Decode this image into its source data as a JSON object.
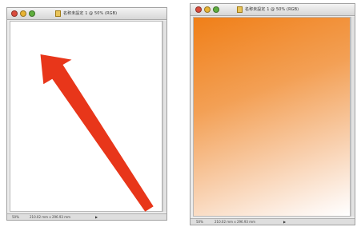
{
  "windows": [
    {
      "title": "名称未設定 1 @ 50% (RGB)",
      "status_zoom": "50%",
      "status_info": "210.02 mm x 296.93 mm",
      "canvas_fill": "white"
    },
    {
      "title": "名称未設定 1 @ 50% (RGB)",
      "status_zoom": "50%",
      "status_info": "210.02 mm x 296.93 mm",
      "canvas_fill": "orange gradient"
    }
  ],
  "colors": {
    "arrow": "#e8361a",
    "gradient_start": "#f07f18",
    "gradient_end": "#ffffff",
    "close_button": "#d94a3c",
    "minimize_button": "#e8b434",
    "zoom_button": "#5fae3e"
  },
  "icons": {
    "arrow": "arrow-icon",
    "document": "document-icon",
    "status_menu": "triangle-icon"
  }
}
